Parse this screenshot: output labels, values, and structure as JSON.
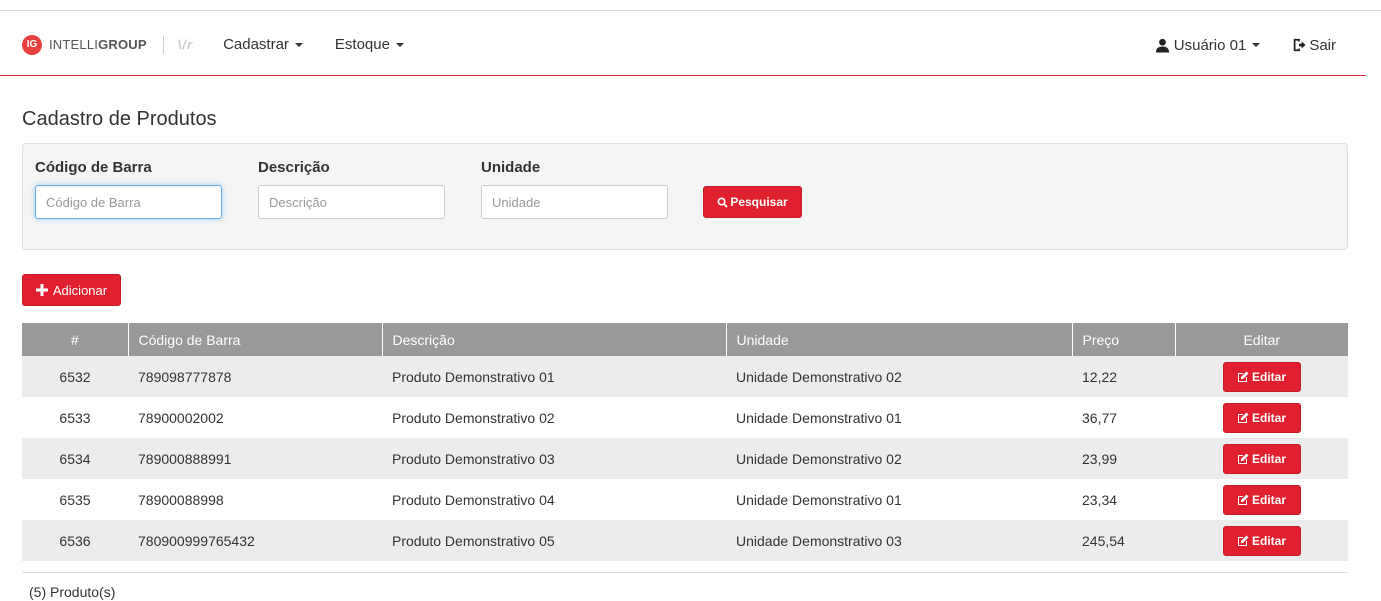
{
  "brand": {
    "badge": "IG",
    "name_light": "INTELLI",
    "name_bold": "GROUP",
    "subbrand": "\\/r"
  },
  "nav": {
    "items": [
      {
        "label": "Cadastrar"
      },
      {
        "label": "Estoque"
      }
    ],
    "user_label": "Usuário 01",
    "logout_label": "Sair"
  },
  "page": {
    "title": "Cadastro de Produtos"
  },
  "filters": {
    "barcode": {
      "label": "Código de Barra",
      "placeholder": "Código de Barra",
      "value": ""
    },
    "description": {
      "label": "Descrição",
      "placeholder": "Descrição",
      "value": ""
    },
    "unit": {
      "label": "Unidade",
      "placeholder": "Unidade",
      "value": ""
    },
    "search_label": "Pesquisar"
  },
  "actions": {
    "add_label": "Adicionar"
  },
  "table": {
    "headers": {
      "id": "#",
      "barcode": "Código de Barra",
      "description": "Descrição",
      "unit": "Unidade",
      "price": "Preço",
      "edit": "Editar"
    },
    "rows": [
      {
        "id": "6532",
        "barcode": "789098777878",
        "description": "Produto Demonstrativo 01",
        "unit": "Unidade Demonstrativo 02",
        "price": "12,22",
        "edit_label": "Editar"
      },
      {
        "id": "6533",
        "barcode": "78900002002",
        "description": "Produto Demonstrativo 02",
        "unit": "Unidade Demonstrativo 01",
        "price": "36,77",
        "edit_label": "Editar"
      },
      {
        "id": "6534",
        "barcode": "789000888991",
        "description": "Produto Demonstrativo 03",
        "unit": "Unidade Demonstrativo 02",
        "price": "23,99",
        "edit_label": "Editar"
      },
      {
        "id": "6535",
        "barcode": "78900088998",
        "description": "Produto Demonstrativo 04",
        "unit": "Unidade Demonstrativo 01",
        "price": "23,34",
        "edit_label": "Editar"
      },
      {
        "id": "6536",
        "barcode": "780900999765432",
        "description": "Produto Demonstrativo 05",
        "unit": "Unidade Demonstrativo 03",
        "price": "245,54",
        "edit_label": "Editar"
      }
    ],
    "footer": "(5) Produto(s)"
  },
  "colors": {
    "accent": "#e0202e",
    "header_bg": "#999999",
    "row_stripe": "#ececec",
    "panel_bg": "#f5f5f5"
  },
  "icons": [
    "user-icon",
    "logout-icon",
    "search-icon",
    "plus-icon",
    "edit-icon",
    "caret-down-icon"
  ]
}
